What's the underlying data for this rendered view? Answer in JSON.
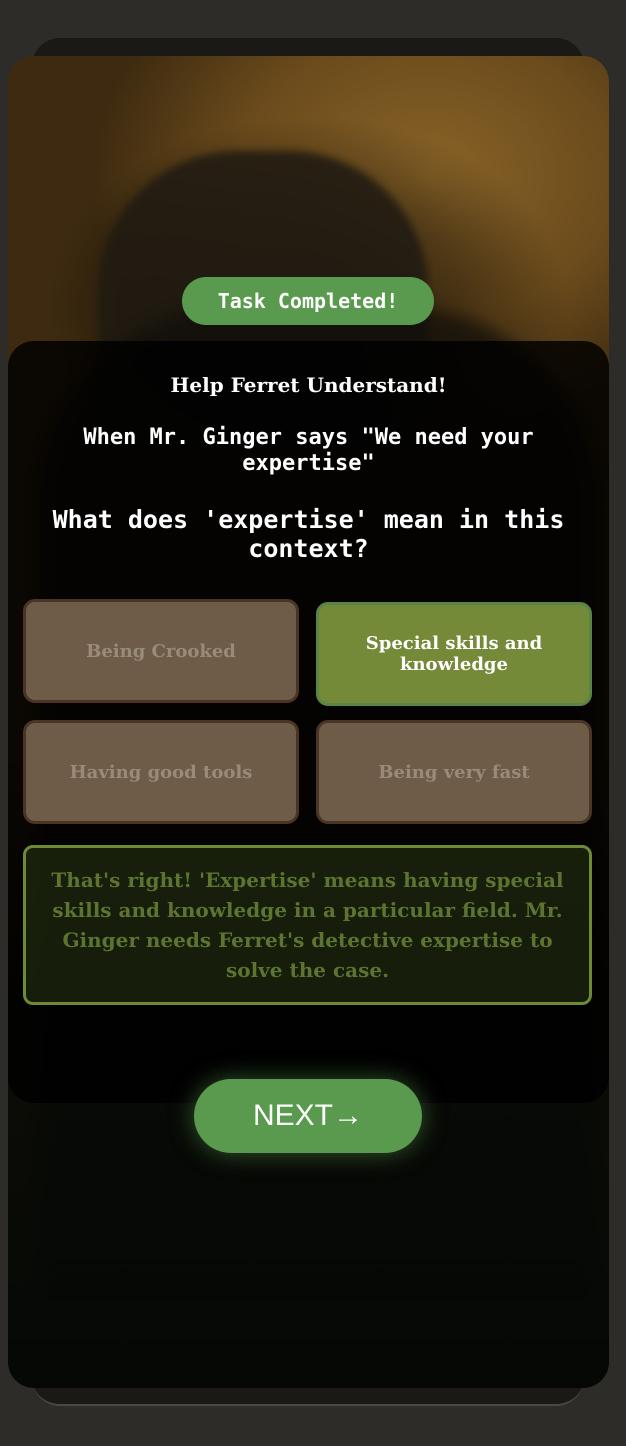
{
  "badge": {
    "label": "Task Completed!"
  },
  "panel": {
    "title": "Help Ferret Understand!",
    "quote": "When Mr. Ginger says \"We need your expertise\"",
    "question": "What does 'expertise' mean in this context?"
  },
  "options": [
    {
      "label": "Being Crooked",
      "state": "dim"
    },
    {
      "label": "Special skills and knowledge",
      "state": "correct"
    },
    {
      "label": "Having good tools",
      "state": "dim"
    },
    {
      "label": "Being very fast",
      "state": "dim"
    }
  ],
  "feedback": {
    "text": "That's right! 'Expertise' means having special skills and knowledge in a particular field. Mr. Ginger needs Ferret's detective expertise to solve the case."
  },
  "next_button": {
    "label": "NEXT→"
  },
  "colors": {
    "accent_green": "#5a9a4e",
    "correct_option": "#748a38",
    "dim_option": "#6e5b48"
  }
}
